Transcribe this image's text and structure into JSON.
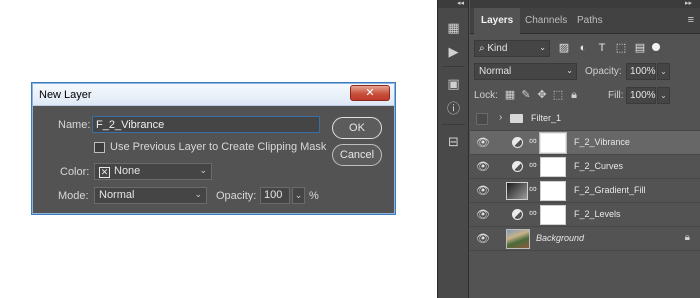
{
  "dialog": {
    "title": "New Layer",
    "close": "✕",
    "name_label": "Name:",
    "name_value": "F_2_Vibrance",
    "clip_label": "Use Previous Layer to Create Clipping Mask",
    "color_label": "Color:",
    "color_value": "None",
    "mode_label": "Mode:",
    "mode_value": "Normal",
    "opacity_label": "Opacity:",
    "opacity_value": "100",
    "percent": "%",
    "ok": "OK",
    "cancel": "Cancel"
  },
  "panel": {
    "collapse_left": "◂◂",
    "collapse_right": "▸▸",
    "tabs": [
      "Layers",
      "Channels",
      "Paths"
    ],
    "menu_icon": "≡",
    "kind_label": "Kind",
    "blend_mode": "Normal",
    "opacity_label": "Opacity:",
    "opacity_value": "100%",
    "lock_label": "Lock:",
    "fill_label": "Fill:",
    "fill_value": "100%"
  },
  "layers": [
    {
      "name": "Filter_1",
      "kind": "group"
    },
    {
      "name": "F_2_Vibrance",
      "kind": "adjustment",
      "selected": true
    },
    {
      "name": "F_2_Curves",
      "kind": "adjustment"
    },
    {
      "name": "F_2_Gradient_Fill",
      "kind": "gradient"
    },
    {
      "name": "F_2_Levels",
      "kind": "adjustment"
    },
    {
      "name": "Background",
      "kind": "background"
    }
  ]
}
